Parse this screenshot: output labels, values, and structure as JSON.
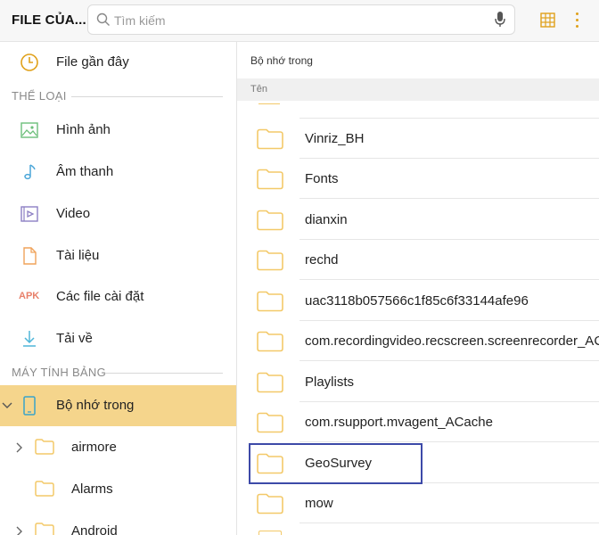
{
  "app": {
    "title": "FILE CỦA..."
  },
  "search": {
    "placeholder": "Tìm kiếm"
  },
  "sidebar": {
    "recent": {
      "label": "File gần đây",
      "icon": "clock-icon"
    },
    "categories_header": "THỂ LOẠI",
    "categories": [
      {
        "label": "Hình ảnh",
        "icon": "image-icon"
      },
      {
        "label": "Âm thanh",
        "icon": "music-note-icon"
      },
      {
        "label": "Video",
        "icon": "video-icon"
      },
      {
        "label": "Tài liệu",
        "icon": "document-icon"
      },
      {
        "label": "Các file cài đặt",
        "icon": "apk-icon",
        "icon_text": "APK"
      },
      {
        "label": "Tải về",
        "icon": "download-icon"
      }
    ],
    "device_header": "MÁY TÍNH BẢNG",
    "device": {
      "label": "Bộ nhớ trong",
      "icon": "tablet-icon",
      "selected": true
    },
    "tree": [
      {
        "label": "airmore",
        "expandable": true
      },
      {
        "label": "Alarms",
        "expandable": false
      },
      {
        "label": "Android",
        "expandable": true
      }
    ]
  },
  "main": {
    "breadcrumb": "Bộ nhớ trong",
    "column_header": "Tên",
    "folders": [
      "Vinriz_BH",
      "Fonts",
      "dianxin",
      "rechd",
      "uac3118b057566c1f85c6f33144afe96",
      "com.recordingvideo.recscreen.screenrecorder_ACache",
      "Playlists",
      "com.rsupport.mvagent_ACache",
      "GeoSurvey",
      "mow"
    ],
    "highlighted": "GeoSurvey"
  },
  "colors": {
    "accent": "#e0a11b",
    "selected_bg": "#f5d58c",
    "highlight_border": "#3d4aa8",
    "folder": "#f3c969"
  }
}
